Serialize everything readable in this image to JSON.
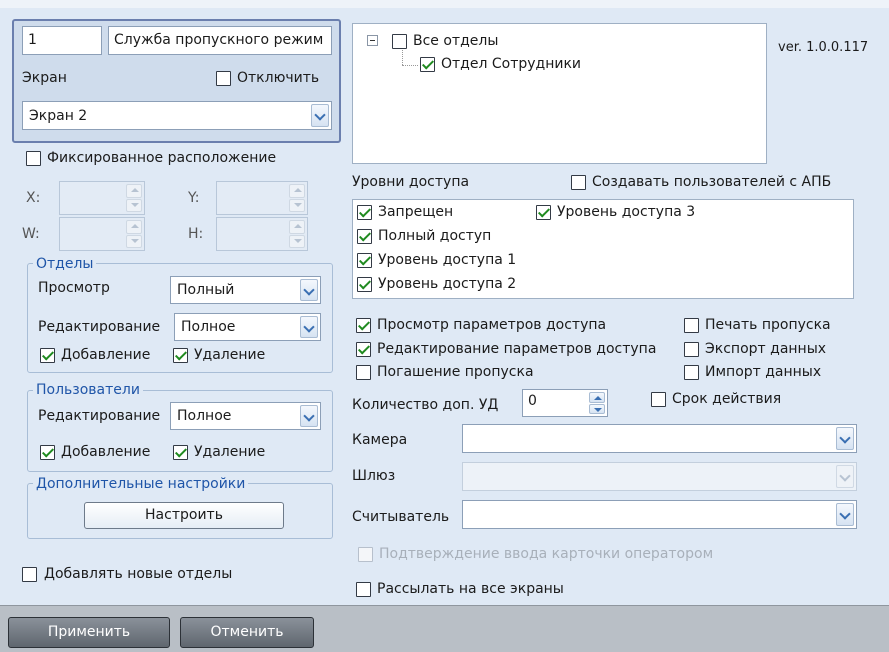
{
  "top": {
    "id_value": "1",
    "name_value": "Служба пропускного режим",
    "screen_label": "Экран",
    "disable_label": "Отключить",
    "screen_value": "Экран 2"
  },
  "fixed_position_label": "Фиксированное расположение",
  "coords": {
    "x": "X:",
    "y": "Y:",
    "w": "W:",
    "h": "H:"
  },
  "departments": {
    "title": "Отделы",
    "view_label": "Просмотр",
    "view_value": "Полный",
    "edit_label": "Редактирование",
    "edit_value": "Полное",
    "add_label": "Добавление",
    "delete_label": "Удаление"
  },
  "users": {
    "title": "Пользователи",
    "edit_label": "Редактирование",
    "edit_value": "Полное",
    "add_label": "Добавление",
    "delete_label": "Удаление"
  },
  "extra": {
    "title": "Дополнительные настройки",
    "configure_label": "Настроить"
  },
  "add_new_departments_label": "Добавлять новые отделы",
  "tree": {
    "root_label": "Все отделы",
    "child_label": "Отдел Сотрудники"
  },
  "version": "ver. 1.0.0.117",
  "access": {
    "title": "Уровни доступа",
    "create_apb_label": "Создавать пользователей с АПБ",
    "levels": [
      "Запрещен",
      "Полный доступ",
      "Уровень доступа 1",
      "Уровень доступа 2",
      "Уровень доступа 3"
    ]
  },
  "permissions": {
    "view_access_params": "Просмотр параметров доступа",
    "edit_access_params": "Редактирование параметров доступа",
    "cancel_pass": "Погашение пропуска",
    "print_pass": "Печать пропуска",
    "export_data": "Экспорт данных",
    "import_data": "Импорт данных"
  },
  "extra_id": {
    "label": "Количество доп. УД",
    "value": "0",
    "validity_label": "Срок действия"
  },
  "camera_label": "Камера",
  "gateway_label": "Шлюз",
  "reader_label": "Считыватель",
  "confirm_card_label": "Подтверждение ввода карточки оператором",
  "send_all_screens_label": "Рассылать на все экраны",
  "footer": {
    "apply_label": "Применить",
    "cancel_label": "Отменить"
  }
}
